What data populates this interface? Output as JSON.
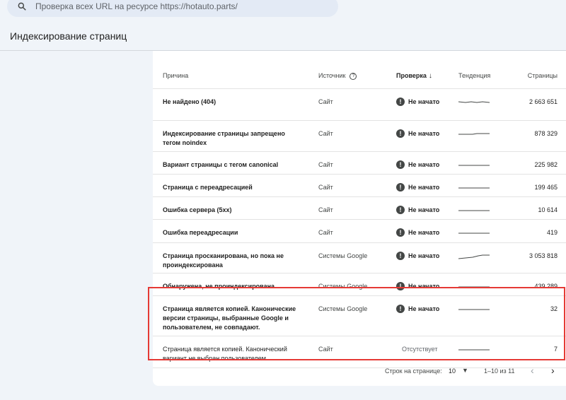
{
  "search": {
    "placeholder": "Проверка всех URL на ресурсе https://hotauto.parts/"
  },
  "page_title": "Индексирование страниц",
  "table": {
    "headers": {
      "reason": "Причина",
      "source": "Источник",
      "check": "Проверка",
      "trend": "Тенденция",
      "pages": "Страницы"
    },
    "rows": [
      {
        "reason": "Не найдено (404)",
        "source": "Сайт",
        "status": "Не начато",
        "pages": "2 663 651"
      },
      {
        "reason": "Индексирование страницы запрещено тегом noindex",
        "source": "Сайт",
        "status": "Не начато",
        "pages": "878 329"
      },
      {
        "reason": "Вариант страницы с тегом canonical",
        "source": "Сайт",
        "status": "Не начато",
        "pages": "225 982"
      },
      {
        "reason": "Страница с переадресацией",
        "source": "Сайт",
        "status": "Не начато",
        "pages": "199 465"
      },
      {
        "reason": "Ошибка сервера (5xx)",
        "source": "Сайт",
        "status": "Не начато",
        "pages": "10 614"
      },
      {
        "reason": "Ошибка переадресации",
        "source": "Сайт",
        "status": "Не начато",
        "pages": "419"
      },
      {
        "reason": "Страница просканирована, но пока не проиндексирована",
        "source": "Системы Google",
        "status": "Не начато",
        "pages": "3 053 818"
      },
      {
        "reason": "Обнаружена, не проиндексирована",
        "source": "Системы Google",
        "status": "Не начато",
        "pages": "439 289"
      },
      {
        "reason": "Страница является копией. Канонические версии страницы, выбранные Google и пользователем, не совпадают.",
        "source": "Системы Google",
        "status": "Не начато",
        "pages": "32"
      },
      {
        "reason": "Страница является копией. Канонический вариант не выбран пользователем.",
        "source": "Сайт",
        "status": "Отсутствует",
        "pages": "7"
      }
    ]
  },
  "pagination": {
    "rows_label": "Строк на странице:",
    "rows_value": "10",
    "range": "1–10 из 11"
  },
  "colors": {
    "highlight": "#e53935",
    "status_icon": "#444746"
  }
}
